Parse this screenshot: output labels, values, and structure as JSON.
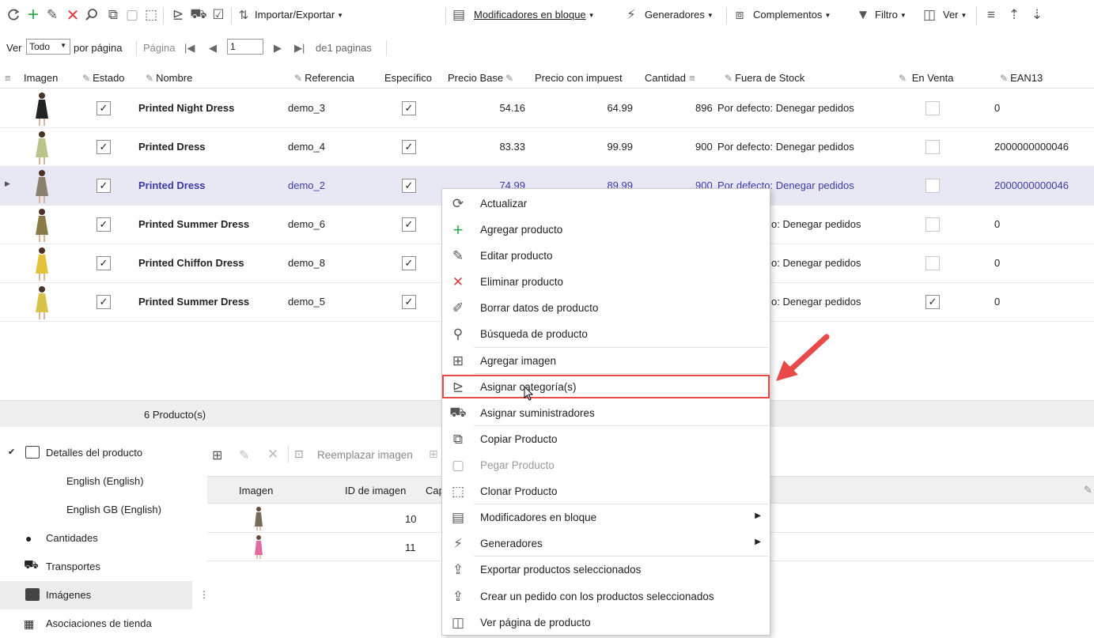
{
  "toolbar": {
    "import_export": "Importar/Exportar",
    "bulk_modifiers": "Modificadores en bloque",
    "generators": "Generadores",
    "addons": "Complementos",
    "filter": "Filtro",
    "view": "Ver",
    "accent_add": "#2ea84a",
    "accent_delete": "#e03c3c"
  },
  "pager": {
    "show_label": "Ver",
    "show_value": "Todo",
    "per_page": "por página",
    "page_label": "Página",
    "page_value": "1",
    "of_pages": "de1 paginas"
  },
  "grid": {
    "columns": {
      "imagen": "Imagen",
      "estado": "Estado",
      "nombre": "Nombre",
      "referencia": "Referencia",
      "especifico": "Específico",
      "precio_base": "Precio Base",
      "precio_impuestos": "Precio con impuest",
      "cantidad": "Cantidad",
      "fuera_stock": "Fuera de Stock",
      "en_venta": "En Venta",
      "ean13": "EAN13"
    },
    "rows": [
      {
        "name": "Printed Night Dress",
        "ref": "demo_3",
        "base": "54.16",
        "tax": "64.99",
        "qty": "896",
        "stock": "Por defecto: Denegar pedidos",
        "ean": "0",
        "on_sale": false
      },
      {
        "name": "Printed Dress",
        "ref": "demo_4",
        "base": "83.33",
        "tax": "99.99",
        "qty": "900",
        "stock": "Por defecto: Denegar pedidos",
        "ean": "2000000000046",
        "on_sale": false
      },
      {
        "name": "Printed Dress",
        "ref": "demo_2",
        "base": "74.99",
        "tax": "89.99",
        "qty": "900",
        "stock": "Por defecto: Denegar pedidos",
        "ean": "2000000000046",
        "on_sale": false
      },
      {
        "name": "Printed Summer Dress",
        "ref": "demo_6",
        "stock": "o: Denegar pedidos",
        "ean": "0",
        "on_sale": false
      },
      {
        "name": "Printed Chiffon Dress",
        "ref": "demo_8",
        "stock": "o: Denegar pedidos",
        "ean": "0",
        "on_sale": false
      },
      {
        "name": "Printed Summer Dress",
        "ref": "demo_5",
        "stock": "o: Denegar pedidos",
        "ean": "0",
        "on_sale": true
      }
    ],
    "count": "6 Producto(s)"
  },
  "left_panel": {
    "details": "Detalles del producto",
    "lang1": "English (English)",
    "lang2": "English GB (English)",
    "quantities": "Cantidades",
    "transports": "Transportes",
    "images": "Imágenes",
    "store_assoc": "Asociaciones de tienda"
  },
  "image_panel": {
    "replace": "Reemplazar imagen",
    "col_image": "Imagen",
    "col_id": "ID de imagen",
    "col_cap": "Cap",
    "rows": [
      {
        "id": "10"
      },
      {
        "id": "11"
      }
    ]
  },
  "context_menu": {
    "items": [
      {
        "label": "Actualizar",
        "icon": "refresh-icon"
      },
      {
        "label": "Agregar producto",
        "icon": "plus-icon"
      },
      {
        "label": "Editar producto",
        "icon": "pencil-icon"
      },
      {
        "label": "Eliminar producto",
        "icon": "delete-icon"
      },
      {
        "label": "Borrar datos de producto",
        "icon": "eraser-icon"
      },
      {
        "label": "Búsqueda de producto",
        "icon": "search-icon"
      },
      {
        "label": "Agregar imagen",
        "icon": "add-image-icon"
      },
      {
        "label": "Asignar categoría(s)",
        "icon": "assign-category-icon"
      },
      {
        "label": "Asignar suministradores",
        "icon": "truck-icon"
      },
      {
        "label": "Copiar Producto",
        "icon": "copy-icon"
      },
      {
        "label": "Pegar Producto",
        "icon": "paste-icon"
      },
      {
        "label": "Clonar Producto",
        "icon": "clone-icon"
      },
      {
        "label": "Modificadores en bloque",
        "icon": "bulk-modifier-icon"
      },
      {
        "label": "Generadores",
        "icon": "lightning-icon"
      },
      {
        "label": "Exportar productos seleccionados",
        "icon": "export-icon"
      },
      {
        "label": "Crear un pedido con los productos seleccionados",
        "icon": "create-order-icon"
      },
      {
        "label": "Ver página de producto",
        "icon": "view-page-icon"
      }
    ],
    "highlight_color": "#e84a4a"
  }
}
